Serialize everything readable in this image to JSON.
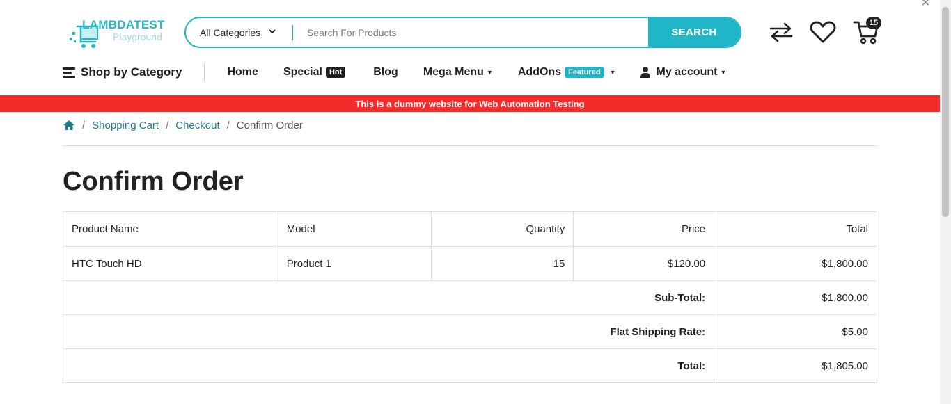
{
  "header": {
    "logo": {
      "brand": "LAMBDATEST",
      "sub": "Playground"
    },
    "search": {
      "category": "All Categories",
      "placeholder": "Search For Products",
      "button": "SEARCH"
    },
    "cart_count": "15",
    "icons": [
      "compare-icon",
      "heart-icon",
      "cart-icon"
    ]
  },
  "nav": {
    "shop_by_category": "Shop by Category",
    "items": [
      {
        "label": "Home"
      },
      {
        "label": "Special",
        "badge": "Hot"
      },
      {
        "label": "Blog"
      },
      {
        "label": "Mega Menu"
      },
      {
        "label": "AddOns",
        "badge": "Featured"
      },
      {
        "label": "My account"
      }
    ]
  },
  "banner": "This is a dummy website for Web Automation Testing",
  "breadcrumb": [
    "Shopping Cart",
    "Checkout",
    "Confirm Order"
  ],
  "page_title": "Confirm Order",
  "table": {
    "headers": [
      "Product Name",
      "Model",
      "Quantity",
      "Price",
      "Total"
    ],
    "row": {
      "name": "HTC Touch HD",
      "model": "Product 1",
      "qty": "15",
      "price": "$120.00",
      "total": "$1,800.00"
    },
    "totals": [
      {
        "label": "Sub-Total:",
        "value": "$1,800.00"
      },
      {
        "label": "Flat Shipping Rate:",
        "value": "$5.00"
      },
      {
        "label": "Total:",
        "value": "$1,805.00"
      }
    ]
  },
  "colors": {
    "accent": "#1fb6c8",
    "banner": "#f42b2b",
    "link": "#1f7a8c"
  }
}
